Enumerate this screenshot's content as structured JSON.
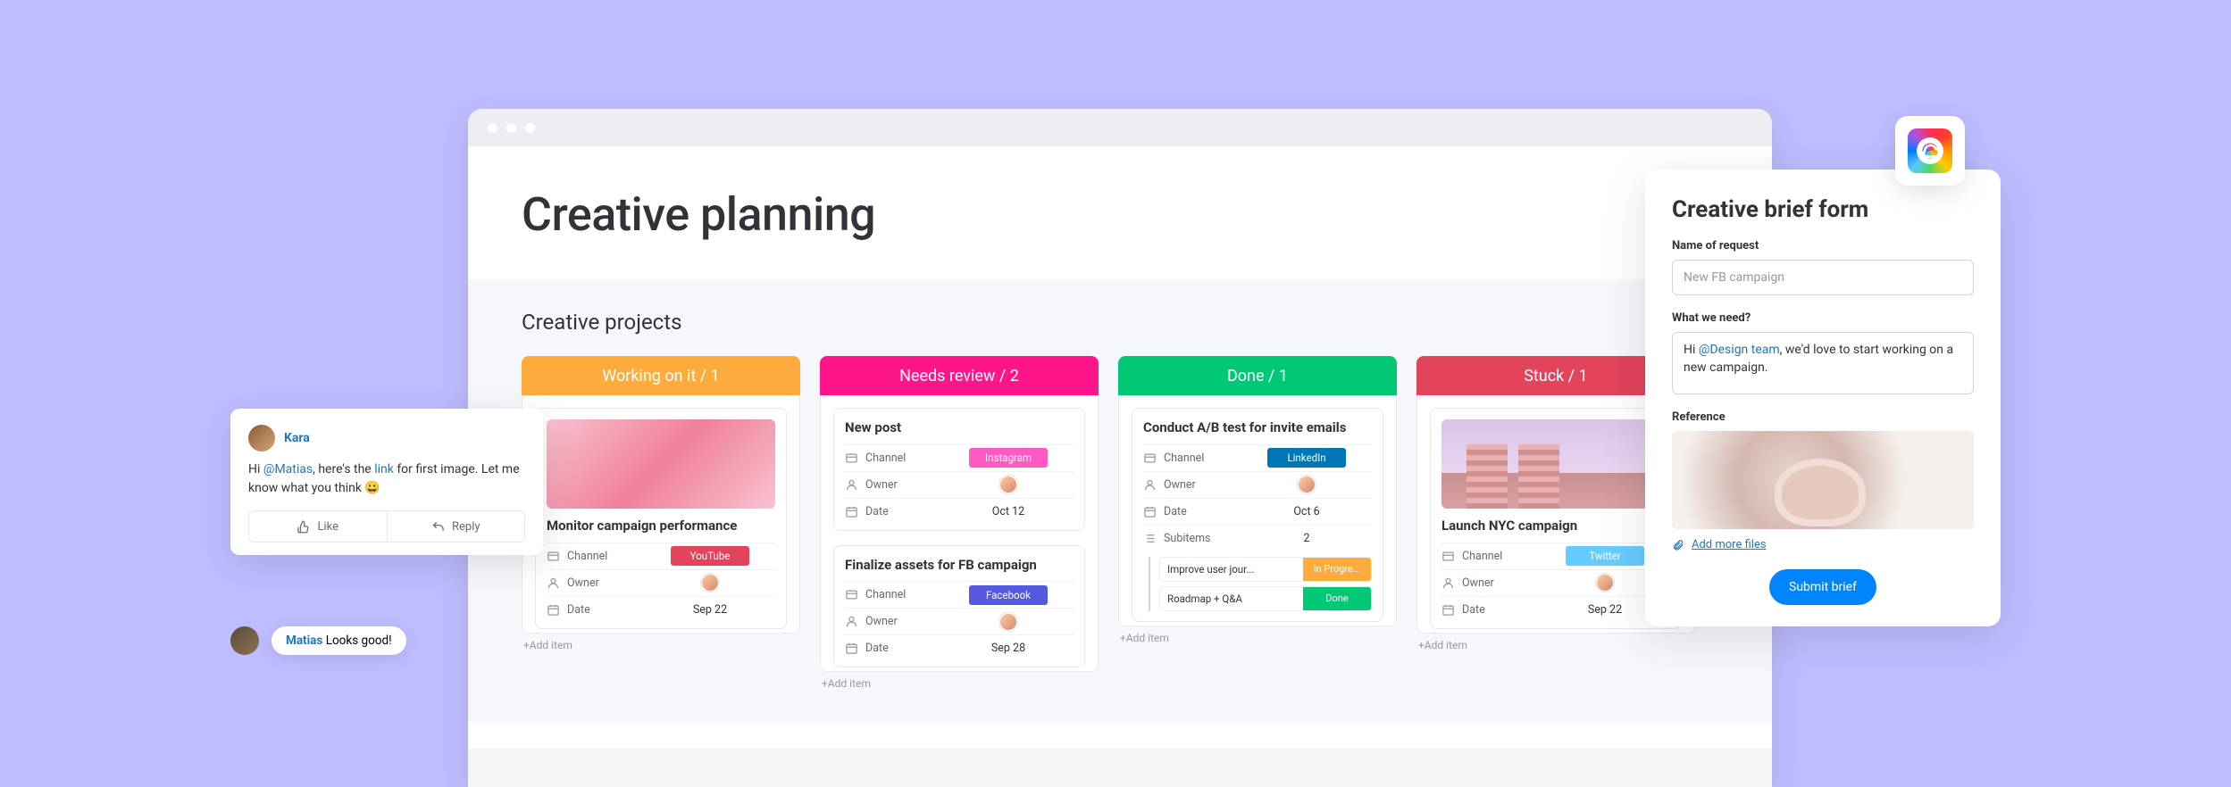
{
  "page": {
    "title": "Creative planning",
    "section": "Creative projects"
  },
  "columns": [
    {
      "key": "working",
      "label": "Working on it / 1",
      "color": "#FDAB3D",
      "cards": [
        {
          "title": "Monitor campaign performance",
          "thumb": "pink",
          "rows": [
            {
              "icon": "channel",
              "label": "Channel",
              "chip": {
                "text": "YouTube",
                "color": "#E2445C"
              }
            },
            {
              "icon": "owner",
              "label": "Owner",
              "avatar": true
            },
            {
              "icon": "date",
              "label": "Date",
              "value": "Sep 22"
            }
          ]
        }
      ],
      "add": "+Add item"
    },
    {
      "key": "review",
      "label": "Needs review / 2",
      "color": "#FF158A",
      "cards": [
        {
          "title": "New post",
          "rows": [
            {
              "icon": "channel",
              "label": "Channel",
              "chip": {
                "text": "Instagram",
                "color": "#FF5AC4"
              }
            },
            {
              "icon": "owner",
              "label": "Owner",
              "avatar": true
            },
            {
              "icon": "date",
              "label": "Date",
              "value": "Oct 12"
            }
          ]
        },
        {
          "title": "Finalize assets for FB campaign",
          "rows": [
            {
              "icon": "channel",
              "label": "Channel",
              "chip": {
                "text": "Facebook",
                "color": "#5559DF"
              }
            },
            {
              "icon": "owner",
              "label": "Owner",
              "avatar": true
            },
            {
              "icon": "date",
              "label": "Date",
              "value": "Sep 28"
            }
          ]
        }
      ],
      "add": "+Add item"
    },
    {
      "key": "done",
      "label": "Done / 1",
      "color": "#00C875",
      "cards": [
        {
          "title": "Conduct A/B test for invite emails",
          "rows": [
            {
              "icon": "channel",
              "label": "Channel",
              "chip": {
                "text": "LinkedIn",
                "color": "#0077B5"
              }
            },
            {
              "icon": "owner",
              "label": "Owner",
              "avatar": true
            },
            {
              "icon": "date",
              "label": "Date",
              "value": "Oct 6"
            },
            {
              "icon": "subitems",
              "label": "Subitems",
              "value": "2"
            }
          ],
          "subitems": [
            {
              "label": "Improve user jour...",
              "chip": {
                "text": "In Progre...",
                "color": "#FDAB3D"
              }
            },
            {
              "label": "Roadmap + Q&A",
              "chip": {
                "text": "Done",
                "color": "#00C875"
              }
            }
          ]
        }
      ],
      "add": "+Add item"
    },
    {
      "key": "stuck",
      "label": "Stuck / 1",
      "color": "#E2445C",
      "cards": [
        {
          "title": "Launch NYC campaign",
          "thumb": "city",
          "rows": [
            {
              "icon": "channel",
              "label": "Channel",
              "chip": {
                "text": "Twitter",
                "color": "#66CCFF"
              }
            },
            {
              "icon": "owner",
              "label": "Owner",
              "avatar": true
            },
            {
              "icon": "date",
              "label": "Date",
              "value": "Sep 22"
            }
          ]
        }
      ],
      "add": "+Add item"
    }
  ],
  "comment": {
    "author": "Kara",
    "text_pre": "Hi ",
    "mention": "@Matias",
    "text_mid": ", here's the ",
    "link": "link",
    "text_post": " for first image. Let me know what you think 😀",
    "like": "Like",
    "reply": "Reply"
  },
  "reply": {
    "author": "Matias",
    "text": " Looks good!"
  },
  "form": {
    "title": "Creative brief form",
    "f1_label": "Name of request",
    "f1_value": "New FB campaign",
    "f2_label": "What we need?",
    "f2_pre": "Hi ",
    "f2_mention": "@Design team",
    "f2_post": ", we'd love to start working on a new campaign.",
    "f3_label": "Reference",
    "add_files": "Add more files",
    "submit": "Submit brief"
  }
}
